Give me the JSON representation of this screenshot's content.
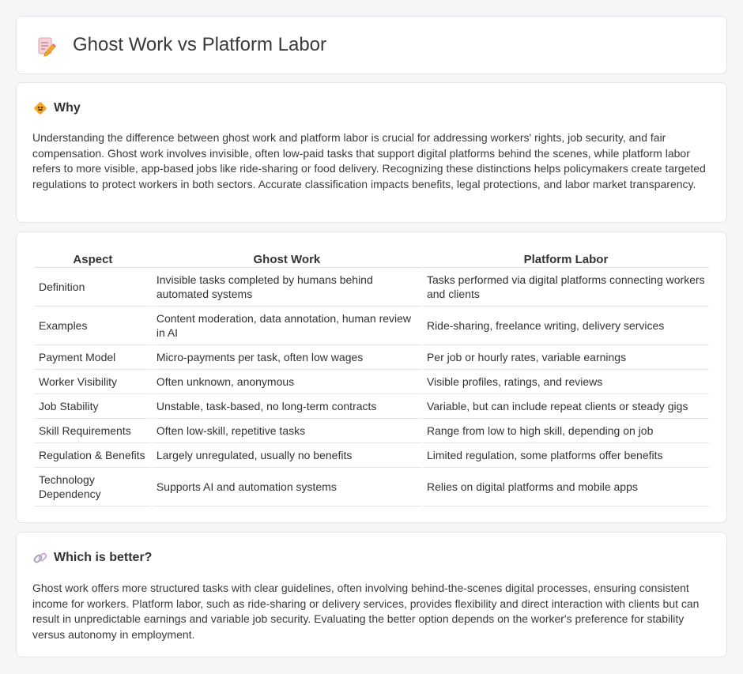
{
  "header": {
    "title": "Ghost Work vs Platform Labor",
    "icon": "document-edit-icon"
  },
  "why": {
    "heading": "Why",
    "icon": "diamond-sign-icon",
    "text": "Understanding the difference between ghost work and platform labor is crucial for addressing workers' rights, job security, and fair compensation. Ghost work involves invisible, often low-paid tasks that support digital platforms behind the scenes, while platform labor refers to more visible, app-based jobs like ride-sharing or food delivery. Recognizing these distinctions helps policymakers create targeted regulations to protect workers in both sectors. Accurate classification impacts benefits, legal protections, and labor market transparency."
  },
  "table": {
    "headers": [
      "Aspect",
      "Ghost Work",
      "Platform Labor"
    ],
    "rows": [
      [
        "Definition",
        "Invisible tasks completed by humans behind automated systems",
        "Tasks performed via digital platforms connecting workers and clients"
      ],
      [
        "Examples",
        "Content moderation, data annotation, human review in AI",
        "Ride-sharing, freelance writing, delivery services"
      ],
      [
        "Payment Model",
        "Micro-payments per task, often low wages",
        "Per job or hourly rates, variable earnings"
      ],
      [
        "Worker Visibility",
        "Often unknown, anonymous",
        "Visible profiles, ratings, and reviews"
      ],
      [
        "Job Stability",
        "Unstable, task-based, no long-term contracts",
        "Variable, but can include repeat clients or steady gigs"
      ],
      [
        "Skill Requirements",
        "Often low-skill, repetitive tasks",
        "Range from low to high skill, depending on job"
      ],
      [
        "Regulation & Benefits",
        "Largely unregulated, usually no benefits",
        "Limited regulation, some platforms offer benefits"
      ],
      [
        "Technology Dependency",
        "Supports AI and automation systems",
        "Relies on digital platforms and mobile apps"
      ]
    ]
  },
  "better": {
    "heading": "Which is better?",
    "icon": "link-icon",
    "text": "Ghost work offers more structured tasks with clear guidelines, often involving behind-the-scenes digital processes, ensuring consistent income for workers. Platform labor, such as ride-sharing or delivery services, provides flexibility and direct interaction with clients but can result in unpredictable earnings and variable job security. Evaluating the better option depends on the worker's preference for stability versus autonomy in employment."
  },
  "colors": {
    "accent_orange": "#f5a623",
    "icon_pink": "#e8637a",
    "link_gray": "#9aa0ad"
  }
}
